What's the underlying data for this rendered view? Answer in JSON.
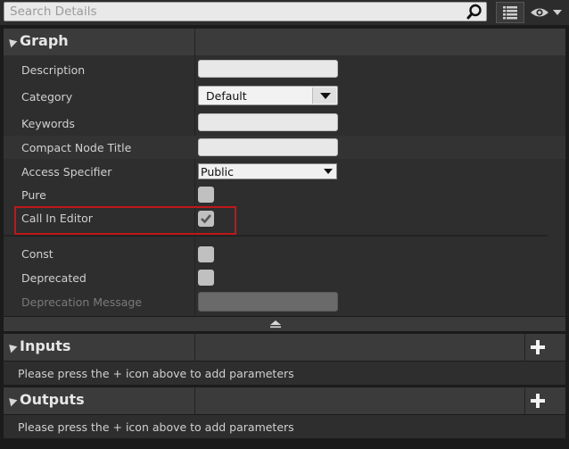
{
  "search": {
    "placeholder": "Search Details"
  },
  "sections": {
    "graph": {
      "title": "Graph"
    },
    "inputs": {
      "title": "Inputs",
      "message": "Please press the + icon above to add parameters"
    },
    "outputs": {
      "title": "Outputs",
      "message": "Please press the + icon above to add parameters"
    }
  },
  "properties": {
    "description": {
      "label": "Description",
      "value": ""
    },
    "category": {
      "label": "Category",
      "value": "Default"
    },
    "keywords": {
      "label": "Keywords",
      "value": ""
    },
    "compact_node_title": {
      "label": "Compact Node Title",
      "value": ""
    },
    "access_specifier": {
      "label": "Access Specifier",
      "value": "Public"
    },
    "pure": {
      "label": "Pure",
      "checked": false
    },
    "call_in_editor": {
      "label": "Call In Editor",
      "checked": true
    },
    "const": {
      "label": "Const",
      "checked": false
    },
    "deprecated": {
      "label": "Deprecated",
      "checked": false
    },
    "deprecation_message": {
      "label": "Deprecation Message",
      "value": "",
      "enabled": false
    }
  },
  "colors": {
    "highlight": "#c01818",
    "panel": "#2e2e2e",
    "header": "#3b3b3b"
  }
}
